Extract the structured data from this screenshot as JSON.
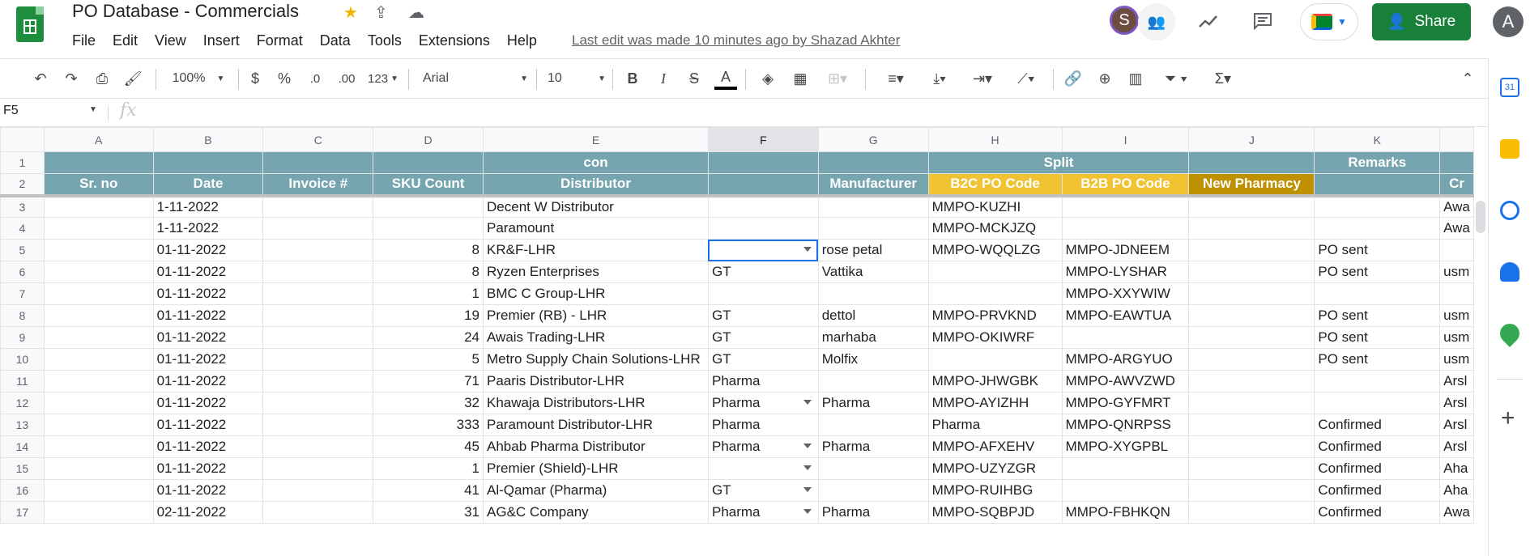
{
  "app": {
    "doc_title": "PO Database - Commercials",
    "last_edit": "Last edit was made 10 minutes ago by Shazad Akhter",
    "menu": [
      "File",
      "Edit",
      "View",
      "Insert",
      "Format",
      "Data",
      "Tools",
      "Extensions",
      "Help"
    ],
    "avatar_letter": "S",
    "account_letter": "A",
    "share_label": "Share"
  },
  "toolbar": {
    "zoom": "100%",
    "currency": "$",
    "percent": "%",
    "dec_decrease": ".0",
    "dec_increase": ".00",
    "format_more": "123",
    "font": "Arial",
    "font_size": "10",
    "bold": "B",
    "italic": "I",
    "strike": "S",
    "text_color": "A"
  },
  "formula": {
    "name_box": "F5",
    "fx": "fx",
    "value": ""
  },
  "columns": [
    "A",
    "B",
    "C",
    "D",
    "E",
    "F",
    "G",
    "H",
    "I",
    "J",
    "K",
    ""
  ],
  "header_row1": {
    "E": "con",
    "HI": "Split",
    "K": "Remarks"
  },
  "header_row2": {
    "A": "Sr. no",
    "B": "Date",
    "C": "Invoice #",
    "D": "SKU Count",
    "E": "Distributor",
    "G": "Manufacturer",
    "H": "B2C PO Code",
    "I": "B2B PO Code",
    "J": "New Pharmacy",
    "L": "Cr"
  },
  "rows": [
    {
      "n": "3",
      "b": "1-11-2022",
      "d": "",
      "e": "Decent W Distributor",
      "f": "",
      "g": "",
      "h": "MMPO-KUZHI",
      "i": "",
      "j": "",
      "k": "",
      "l": "Awa"
    },
    {
      "n": "4",
      "b": "1-11-2022",
      "d": "",
      "e": "Paramount",
      "f": "",
      "g": "",
      "h": "MMPO-MCKJZQ",
      "i": "",
      "j": "",
      "k": "",
      "l": "Awa"
    },
    {
      "n": "5",
      "b": "01-11-2022",
      "d": "8",
      "e": "KR&F-LHR",
      "f": "",
      "g": "rose petal",
      "h": "MMPO-WQQLZG",
      "i": "MMPO-JDNEEM",
      "j": "",
      "k": "PO sent",
      "l": ""
    },
    {
      "n": "6",
      "b": "01-11-2022",
      "d": "8",
      "e": "Ryzen Enterprises",
      "f": "GT",
      "g": "Vattika",
      "h": "",
      "i": "MMPO-LYSHAR",
      "j": "",
      "k": "PO sent",
      "l": "usm"
    },
    {
      "n": "7",
      "b": "01-11-2022",
      "d": "1",
      "e": "BMC C Group-LHR",
      "f": "",
      "g": "",
      "h": "",
      "i": "MMPO-XXYWIW",
      "j": "",
      "k": "",
      "l": ""
    },
    {
      "n": "8",
      "b": "01-11-2022",
      "d": "19",
      "e": "Premier (RB) - LHR",
      "f": "GT",
      "g": "dettol",
      "h": "MMPO-PRVKND",
      "i": "MMPO-EAWTUA",
      "j": "",
      "k": "PO sent",
      "l": "usm"
    },
    {
      "n": "9",
      "b": "01-11-2022",
      "d": "24",
      "e": "Awais Trading-LHR",
      "f": "GT",
      "g": "marhaba",
      "h": "MMPO-OKIWRF",
      "i": "",
      "j": "",
      "k": "PO sent",
      "l": "usm"
    },
    {
      "n": "10",
      "b": "01-11-2022",
      "d": "5",
      "e": "Metro Supply Chain Solutions-LHR",
      "f": "GT",
      "g": "Molfix",
      "h": "",
      "i": "MMPO-ARGYUO",
      "j": "",
      "k": "PO sent",
      "l": "usm"
    },
    {
      "n": "11",
      "b": "01-11-2022",
      "d": "71",
      "e": "Paaris Distributor-LHR",
      "f": "Pharma",
      "g": "",
      "h": "MMPO-JHWGBK",
      "i": "MMPO-AWVZWD",
      "j": "",
      "k": "",
      "l": "Arsl"
    },
    {
      "n": "12",
      "b": "01-11-2022",
      "d": "32",
      "e": "Khawaja Distributors-LHR",
      "f": "Pharma",
      "g": "Pharma",
      "h": "MMPO-AYIZHH",
      "i": "MMPO-GYFMRT",
      "j": "",
      "k": "",
      "l": "Arsl"
    },
    {
      "n": "13",
      "b": "01-11-2022",
      "d": "333",
      "e": "Paramount Distributor-LHR",
      "f": "Pharma",
      "g": "",
      "h": "Pharma",
      "i": "MMPO-QNRPSS",
      "j": "",
      "k": "Confirmed",
      "l": "Arsl"
    },
    {
      "n": "14",
      "b": "01-11-2022",
      "d": "45",
      "e": "Ahbab Pharma Distributor",
      "f": "Pharma",
      "g": "Pharma",
      "h": "MMPO-AFXEHV",
      "i": "MMPO-XYGPBL",
      "j": "",
      "k": "Confirmed",
      "l": "Arsl"
    },
    {
      "n": "15",
      "b": "01-11-2022",
      "d": "1",
      "e": "Premier (Shield)-LHR",
      "f": "",
      "g": "",
      "h": "MMPO-UZYZGR",
      "i": "",
      "j": "",
      "k": "Confirmed",
      "l": "Aha"
    },
    {
      "n": "16",
      "b": "01-11-2022",
      "d": "41",
      "e": "Al-Qamar (Pharma)",
      "f": "GT",
      "g": "",
      "h": "MMPO-RUIHBG",
      "i": "",
      "j": "",
      "k": "Confirmed",
      "l": "Aha"
    },
    {
      "n": "17",
      "b": "02-11-2022",
      "d": "31",
      "e": "AG&C Company",
      "f": "Pharma",
      "g": "Pharma",
      "h": "MMPO-SQBPJD",
      "i": "MMPO-FBHKQN",
      "j": "",
      "k": "Confirmed",
      "l": "Awa"
    }
  ],
  "colors": {
    "header_teal": "#76a5af",
    "header_yellow": "#f1c232",
    "header_gold": "#bf9000",
    "share_green": "#188038"
  }
}
